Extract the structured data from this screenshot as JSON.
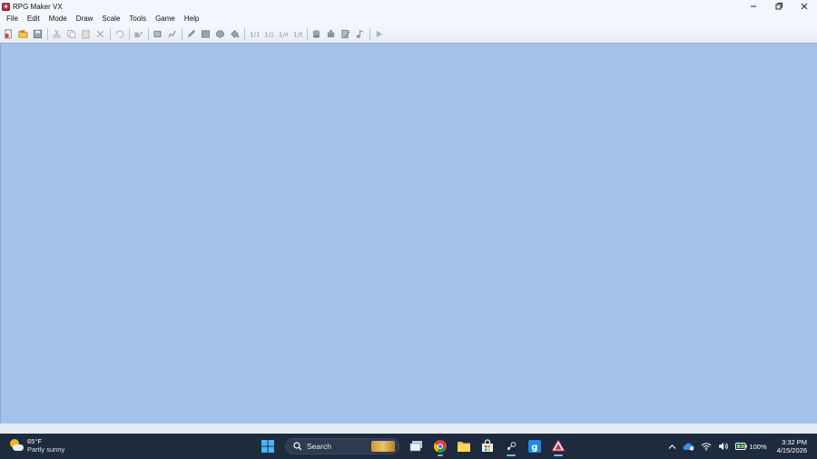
{
  "window": {
    "title": "RPG Maker VX",
    "minimize_symbol": "─",
    "maximize_symbol": "❐",
    "close_symbol": "✕"
  },
  "menu": {
    "items": [
      "File",
      "Edit",
      "Mode",
      "Draw",
      "Scale",
      "Tools",
      "Game",
      "Help"
    ]
  },
  "toolbar": {
    "buttons": [
      {
        "name": "new-project-icon",
        "enabled": true
      },
      {
        "name": "open-project-icon",
        "enabled": true
      },
      {
        "name": "save-project-icon",
        "enabled": true
      },
      {
        "name": "cut-icon",
        "enabled": false
      },
      {
        "name": "copy-icon",
        "enabled": false
      },
      {
        "name": "paste-icon",
        "enabled": false
      },
      {
        "name": "delete-icon",
        "enabled": false
      },
      {
        "name": "undo-icon",
        "enabled": false
      },
      {
        "name": "map-mode-icon",
        "enabled": false
      },
      {
        "name": "event-mode-icon",
        "enabled": false
      },
      {
        "name": "pencil-icon",
        "enabled": false
      },
      {
        "name": "rectangle-icon",
        "enabled": false
      },
      {
        "name": "ellipse-icon",
        "enabled": false
      },
      {
        "name": "fill-icon",
        "enabled": false
      },
      {
        "name": "scale-1-1-icon",
        "enabled": false
      },
      {
        "name": "scale-1-2-icon",
        "enabled": false
      },
      {
        "name": "scale-1-4-icon",
        "enabled": false
      },
      {
        "name": "scale-1-8-icon",
        "enabled": false
      },
      {
        "name": "database-icon",
        "enabled": false
      },
      {
        "name": "resource-manager-icon",
        "enabled": false
      },
      {
        "name": "script-editor-icon",
        "enabled": false
      },
      {
        "name": "sound-test-icon",
        "enabled": false
      },
      {
        "name": "playtest-icon",
        "enabled": false
      }
    ]
  },
  "taskbar": {
    "weather": {
      "temp": "65°F",
      "condition": "Partly sunny"
    },
    "search": {
      "label": "Search"
    },
    "apps": [
      {
        "name": "windows-start-icon",
        "active": false
      },
      {
        "name": "task-view-icon",
        "active": false
      },
      {
        "name": "chrome-icon",
        "active": false
      },
      {
        "name": "file-explorer-icon",
        "active": false
      },
      {
        "name": "microsoft-store-icon",
        "active": false
      },
      {
        "name": "steam-icon",
        "active": true
      },
      {
        "name": "g-app-icon",
        "active": false
      },
      {
        "name": "rpg-maker-icon",
        "active": true
      }
    ],
    "tray": {
      "battery": "100%",
      "time": "3:32 PM",
      "date": "4/15/2026"
    }
  },
  "colors": {
    "workspace": "#a3c2ea",
    "taskbar": "#1e2a3e",
    "chrome_bg": "#f3f6fc",
    "active_indicator": "#5ec3f0"
  }
}
